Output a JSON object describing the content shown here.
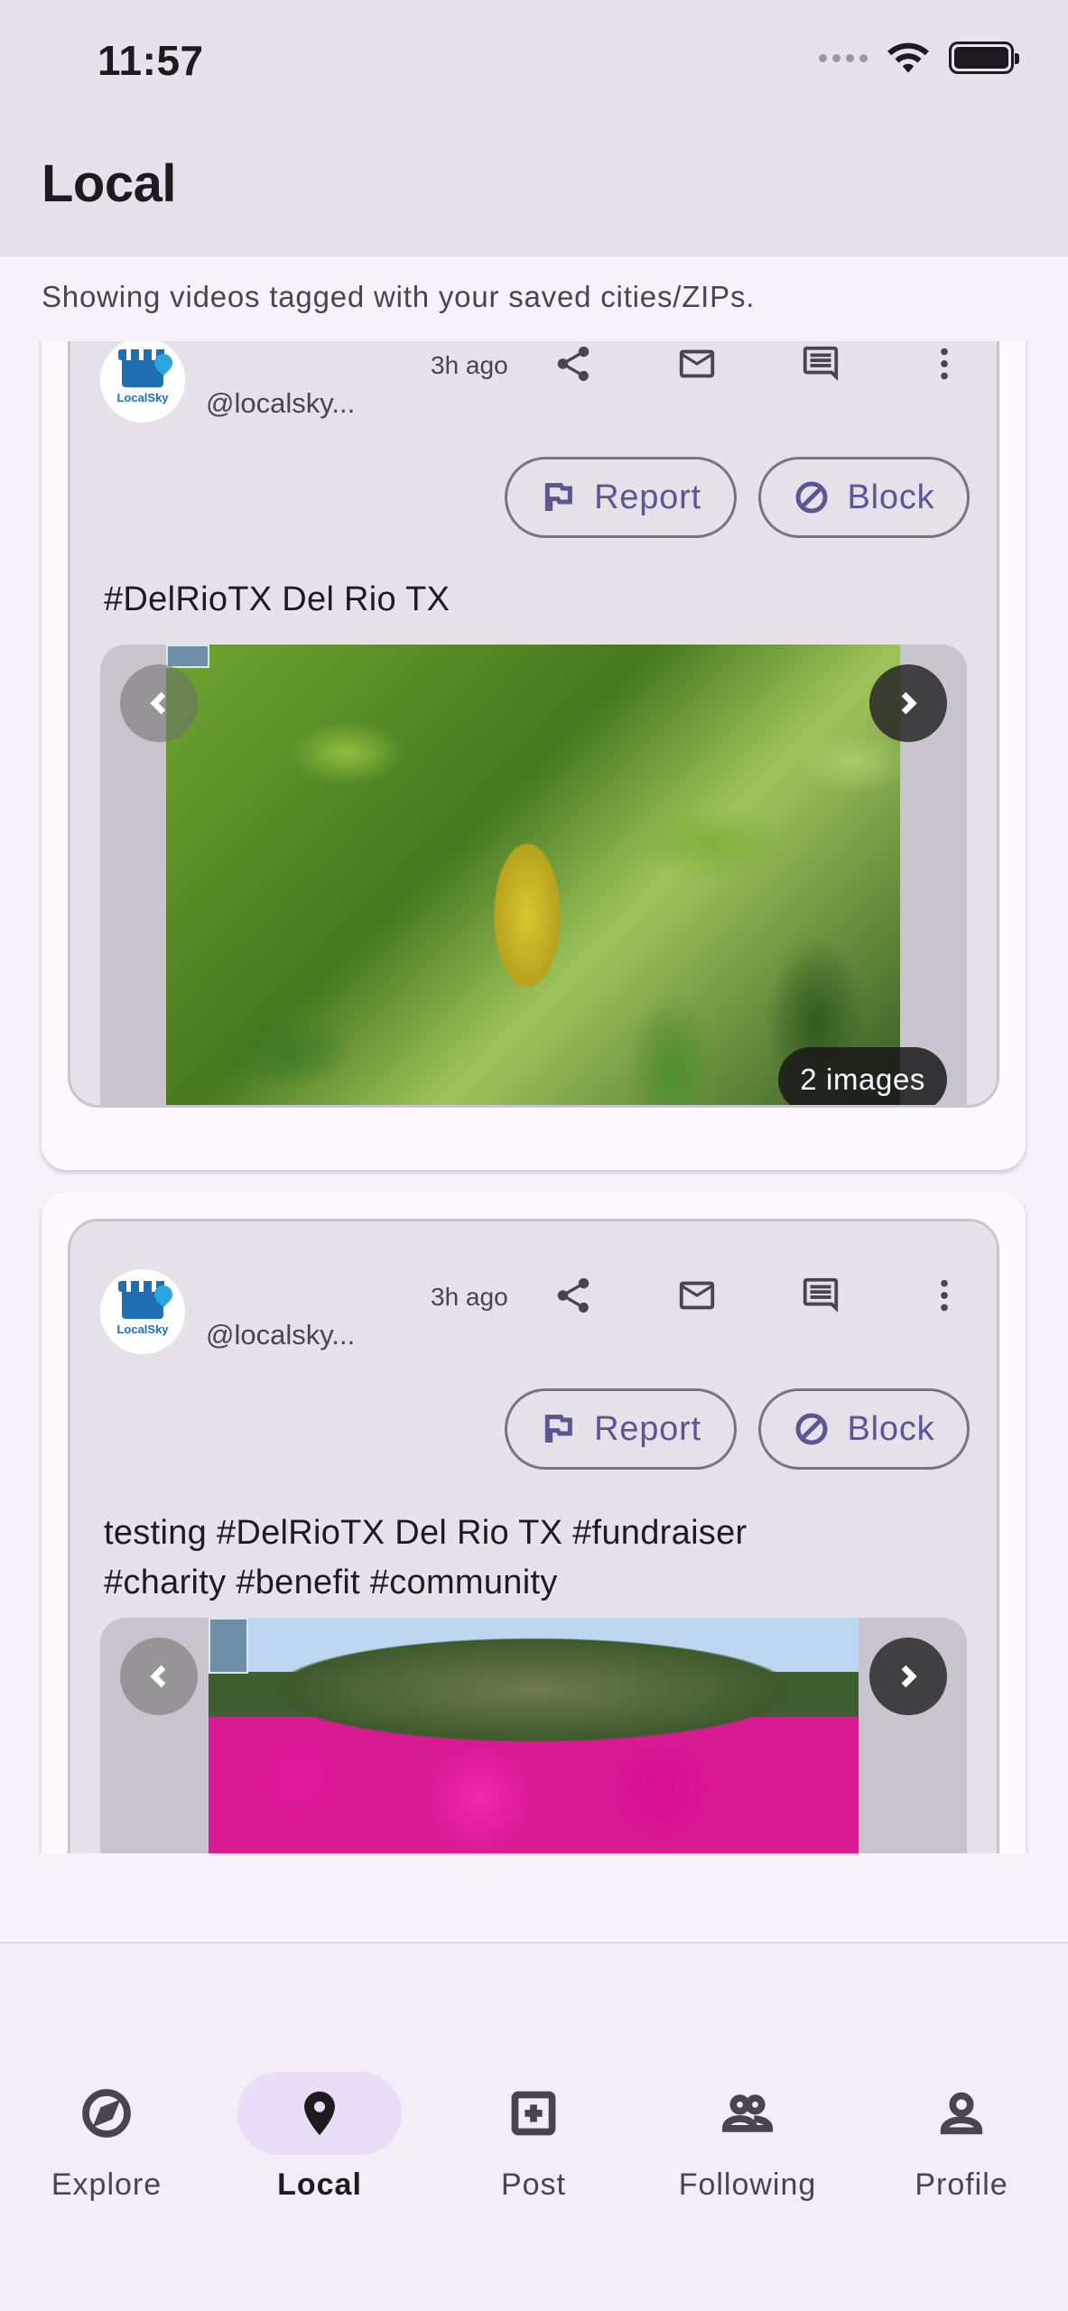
{
  "status_bar": {
    "time": "11:57"
  },
  "app_bar": {
    "title": "Local"
  },
  "subtitle": "Showing videos tagged with your saved cities/ZIPs.",
  "posts": [
    {
      "avatar_brand": "LocalSky",
      "handle": "@localsky...",
      "time_ago": "3h ago",
      "report_label": "Report",
      "block_label": "Block",
      "caption_lines": [
        "#DelRioTX Del Rio TX"
      ],
      "image_count_label": "2 images"
    },
    {
      "avatar_brand": "LocalSky",
      "handle": "@localsky...",
      "time_ago": "3h ago",
      "report_label": "Report",
      "block_label": "Block",
      "caption_lines": [
        "testing #DelRioTX Del Rio TX #fundraiser",
        "#charity #benefit #community"
      ]
    }
  ],
  "bottom_nav": {
    "items": [
      {
        "label": "Explore",
        "icon": "compass-icon",
        "active": false
      },
      {
        "label": "Local",
        "icon": "location-pin-icon",
        "active": true
      },
      {
        "label": "Post",
        "icon": "add-box-icon",
        "active": false
      },
      {
        "label": "Following",
        "icon": "people-icon",
        "active": false
      },
      {
        "label": "Profile",
        "icon": "person-icon",
        "active": false
      }
    ]
  },
  "colors": {
    "app_bar_bg": "#e7e1ec",
    "accent": "#5c5694",
    "nav_active_pill": "#e8def8"
  }
}
